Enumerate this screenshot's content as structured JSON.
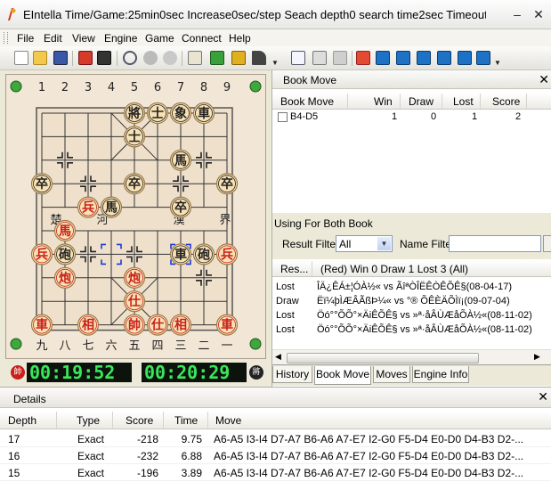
{
  "window": {
    "title": "EIntella Time/Game:25min0sec Increase0sec/step Seach depth0 search time2sec Timeout ..."
  },
  "menu": [
    "File",
    "Edit",
    "View",
    "Engine",
    "Game",
    "Connect",
    "Help"
  ],
  "toolbar": {
    "icons": [
      "new-icon",
      "open-icon",
      "save-icon",
      "engine-red-icon",
      "engine-black-icon",
      "search-icon",
      "stop-icon",
      "refresh-icon",
      "edit-board-icon",
      "load-icon",
      "lock-icon",
      "hammer-icon",
      "copy-icon",
      "paste-icon",
      "clipboard-icon",
      "undo-icon",
      "first-icon",
      "prev-icon",
      "play-icon",
      "next-icon",
      "last-icon"
    ]
  },
  "board": {
    "top_numbers": [
      "1",
      "2",
      "3",
      "4",
      "5",
      "6",
      "7",
      "8",
      "9"
    ],
    "bottom_numbers": [
      "九",
      "八",
      "七",
      "六",
      "五",
      "四",
      "三",
      "二",
      "一"
    ],
    "river": [
      "楚",
      "河",
      "漢",
      "界"
    ],
    "pieces": [
      {
        "ch": "將",
        "side": "black",
        "f": 4,
        "r": 0
      },
      {
        "ch": "士",
        "side": "black",
        "f": 5,
        "r": 0
      },
      {
        "ch": "象",
        "side": "black",
        "f": 6,
        "r": 0
      },
      {
        "ch": "車",
        "side": "black",
        "f": 7,
        "r": 0
      },
      {
        "ch": "士",
        "side": "black",
        "f": 4,
        "r": 1
      },
      {
        "ch": "馬",
        "side": "black",
        "f": 6,
        "r": 2
      },
      {
        "ch": "卒",
        "side": "black",
        "f": 0,
        "r": 3
      },
      {
        "ch": "卒",
        "side": "black",
        "f": 4,
        "r": 3
      },
      {
        "ch": "卒",
        "side": "black",
        "f": 8,
        "r": 3
      },
      {
        "ch": "兵",
        "side": "red",
        "f": 2,
        "r": 4
      },
      {
        "ch": "馬",
        "side": "black",
        "f": 3,
        "r": 4
      },
      {
        "ch": "卒",
        "side": "black",
        "f": 6,
        "r": 4
      },
      {
        "ch": "馬",
        "side": "red",
        "f": 1,
        "r": 5
      },
      {
        "ch": "兵",
        "side": "red",
        "f": 0,
        "r": 6
      },
      {
        "ch": "砲",
        "side": "black",
        "f": 1,
        "r": 6
      },
      {
        "ch": "車",
        "side": "black",
        "f": 6,
        "r": 6
      },
      {
        "ch": "砲",
        "side": "black",
        "f": 7,
        "r": 6
      },
      {
        "ch": "兵",
        "side": "red",
        "f": 8,
        "r": 6
      },
      {
        "ch": "炮",
        "side": "red",
        "f": 1,
        "r": 7
      },
      {
        "ch": "炮",
        "side": "red",
        "f": 4,
        "r": 7
      },
      {
        "ch": "仕",
        "side": "red",
        "f": 4,
        "r": 8
      },
      {
        "ch": "車",
        "side": "red",
        "f": 0,
        "r": 9
      },
      {
        "ch": "相",
        "side": "red",
        "f": 2,
        "r": 9
      },
      {
        "ch": "帥",
        "side": "red",
        "f": 4,
        "r": 9
      },
      {
        "ch": "仕",
        "side": "red",
        "f": 5,
        "r": 9
      },
      {
        "ch": "相",
        "side": "red",
        "f": 6,
        "r": 9
      },
      {
        "ch": "車",
        "side": "red",
        "f": 8,
        "r": 9
      }
    ],
    "selection_marks": [
      {
        "f": 3,
        "r": 6
      },
      {
        "f": 6,
        "r": 6
      }
    ]
  },
  "clock": {
    "red_badge": "帥",
    "black_badge": "將",
    "red_time": "00:19:52",
    "black_time": "00:20:29"
  },
  "book_move": {
    "panel_title": "Book Move",
    "columns": [
      "Book Move",
      "Win",
      "Draw",
      "Lost",
      "Score"
    ],
    "rows": [
      {
        "move": "B4-D5",
        "win": "1",
        "draw": "0",
        "lost": "1",
        "score": "2"
      }
    ]
  },
  "filters": {
    "section_label": "Using For Both Book",
    "result_filter_label": "Result Filter",
    "result_filter_value": "All",
    "name_filter_label": "Name Filter",
    "name_filter_value": ""
  },
  "history": {
    "columns": [
      "Res...",
      "(Red) Win 0 Draw 1 Lost 3 (All)"
    ],
    "rows": [
      {
        "result": "Lost",
        "game": "ÎÄ¿ÊÁ±¦ÓÀ½«  vs ÃîªÒÎËÊÒÊÕÊ§(08-04-17)"
      },
      {
        "result": "Draw",
        "game": "Ëï¼þÌÆÂÃßÞ¼«  vs °® ÕÊÈÄÕÌï¡(09-07-04)"
      },
      {
        "result": "Lost",
        "game": "Öó°°ÕÕ°×ÄiÊÕÊ§ vs »ª·åÂÙÆåÕÀ½«(08-11-02)"
      },
      {
        "result": "Lost",
        "game": "Öó°°ÕÕ°×ÄiÊÕÊ§ vs »ª·åÂÙÆåÕÀ½«(08-11-02)"
      }
    ]
  },
  "tabs": [
    "History",
    "Book Move",
    "Moves",
    "Engine Info"
  ],
  "active_tab": "Book Move",
  "details": {
    "panel_title": "Details",
    "columns": [
      "Depth",
      "Type",
      "Score",
      "Time",
      "Move"
    ],
    "rows": [
      {
        "depth": "17",
        "type": "Exact",
        "score": "-218",
        "time": "9.75",
        "move": "A6-A5 I3-I4 D7-A7 B6-A6 A7-E7 I2-G0 F5-D4 E0-D0 D4-B3 D2-..."
      },
      {
        "depth": "16",
        "type": "Exact",
        "score": "-232",
        "time": "6.88",
        "move": "A6-A5 I3-I4 D7-A7 B6-A6 A7-E7 I2-G0 F5-D4 E0-D0 D4-B3 D2-..."
      },
      {
        "depth": "15",
        "type": "Exact",
        "score": "-196",
        "time": "3.89",
        "move": "A6-A5 I3-I4 D7-A7 B6-A6 A7-E7 I2-G0 F5-D4 E0-D0 D4-B3 D2-..."
      }
    ]
  },
  "colors": {
    "red": "#c8201c",
    "black": "#222222",
    "piece_fill": "#f8e2b4",
    "clock_green": "#39e85a",
    "accent": "#d2361e"
  }
}
